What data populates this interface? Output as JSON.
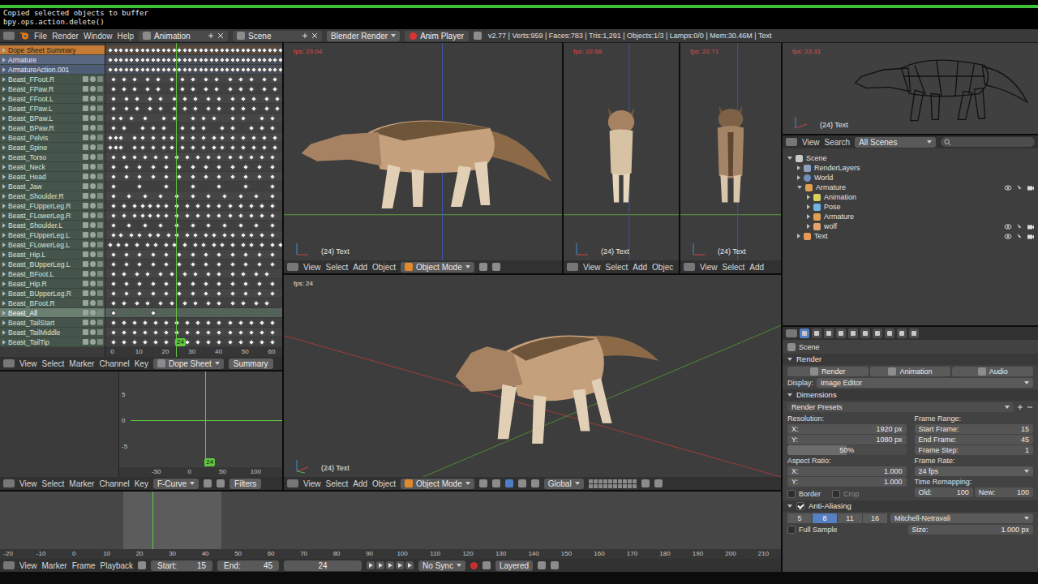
{
  "info": {
    "lines": [
      "Copied selected objects to buffer",
      "bpy.ops.action.delete()"
    ],
    "progress": 1
  },
  "topbar": {
    "menus": [
      "File",
      "Render",
      "Window",
      "Help"
    ],
    "screen_layout": "Animation",
    "scene": "Scene",
    "engine": "Blender Render",
    "anim_player": "Anim Player",
    "stats": "v2.77 | Verts:959 | Faces:783 | Tris:1,291 | Objects:1/3 | Lamps:0/0 | Mem:30.46M | Text"
  },
  "dope_sheet": {
    "rows": [
      {
        "label": "Dope Sheet Summary",
        "kind": "summary",
        "selected": false,
        "keys": [
          -1,
          1,
          3,
          5,
          7,
          9,
          11,
          13,
          15,
          17,
          19,
          21,
          23,
          25,
          27,
          29,
          31,
          33,
          35,
          37,
          39,
          41,
          43,
          45,
          47,
          49,
          51,
          53,
          55,
          57,
          59,
          61,
          63
        ]
      },
      {
        "label": "Armature",
        "kind": "object",
        "selected": false,
        "keys": [
          -1,
          1,
          3,
          5,
          7,
          9,
          11,
          13,
          15,
          17,
          19,
          21,
          23,
          25,
          27,
          29,
          31,
          33,
          35,
          37,
          39,
          41,
          43,
          45,
          47,
          49,
          51,
          53,
          55,
          57,
          59,
          61,
          63
        ]
      },
      {
        "label": "ArmatureAction.001",
        "kind": "action",
        "selected": false,
        "keys": [
          -1,
          1,
          3,
          5,
          7,
          9,
          11,
          13,
          15,
          17,
          19,
          21,
          23,
          25,
          27,
          29,
          31,
          33,
          35,
          37,
          39,
          41,
          43,
          45,
          47,
          49,
          51,
          53,
          55,
          57,
          59,
          61,
          63
        ]
      },
      {
        "label": "Beast_FFoot.R",
        "kind": "bone",
        "selected": false,
        "keys": [
          0,
          4,
          8,
          13,
          17,
          22,
          26,
          30,
          35,
          39,
          44,
          48,
          52,
          57,
          61
        ]
      },
      {
        "label": "Beast_FPaw.R",
        "kind": "bone",
        "selected": false,
        "keys": [
          0,
          4,
          8,
          13,
          17,
          22,
          26,
          30,
          35,
          39,
          44,
          48,
          52,
          57,
          61
        ]
      },
      {
        "label": "Beast_FFoot.L",
        "kind": "bone",
        "selected": false,
        "keys": [
          0,
          5,
          9,
          14,
          18,
          23,
          27,
          31,
          36,
          40,
          45,
          49,
          53,
          58,
          62
        ]
      },
      {
        "label": "Beast_FPaw.L",
        "kind": "bone",
        "selected": false,
        "keys": [
          0,
          5,
          9,
          14,
          18,
          23,
          27,
          31,
          36,
          40,
          45,
          49,
          53,
          58,
          62
        ]
      },
      {
        "label": "Beast_BPaw.L",
        "kind": "bone",
        "selected": false,
        "keys": [
          0,
          3,
          7,
          12,
          19,
          23,
          30,
          34,
          38,
          45,
          49,
          56,
          60
        ]
      },
      {
        "label": "Beast_BPaw.R",
        "kind": "bone",
        "selected": false,
        "keys": [
          0,
          4,
          11,
          15,
          19,
          26,
          30,
          34,
          41,
          45,
          52,
          56,
          60
        ]
      },
      {
        "label": "Beast_Pelvis",
        "kind": "bone",
        "selected": false,
        "keys": [
          -1,
          1,
          3,
          8,
          11,
          15,
          19,
          22,
          26,
          30,
          34,
          38,
          41,
          45,
          49,
          53,
          57,
          61
        ]
      },
      {
        "label": "Beast_Spine",
        "kind": "bone",
        "selected": false,
        "keys": [
          -1,
          1,
          3,
          8,
          11,
          15,
          19,
          22,
          26,
          30,
          34,
          38,
          41,
          45,
          49,
          53,
          57,
          61
        ]
      },
      {
        "label": "Beast_Torso",
        "kind": "bone",
        "selected": false,
        "keys": [
          0,
          4,
          8,
          12,
          16,
          20,
          24,
          28,
          32,
          36,
          40,
          44,
          48,
          52,
          56,
          60
        ]
      },
      {
        "label": "Beast_Neck",
        "kind": "bone",
        "selected": false,
        "keys": [
          0,
          5,
          10,
          15,
          20,
          25,
          30,
          35,
          40,
          45,
          50,
          55,
          60
        ]
      },
      {
        "label": "Beast_Head",
        "kind": "bone",
        "selected": false,
        "keys": [
          0,
          5,
          10,
          15,
          20,
          25,
          30,
          35,
          40,
          45,
          50,
          55,
          60
        ]
      },
      {
        "label": "Beast_Jaw",
        "kind": "bone",
        "selected": false,
        "keys": [
          0,
          10,
          20,
          30,
          40,
          50,
          60
        ]
      },
      {
        "label": "Beast_Shoulder.R",
        "kind": "bone",
        "selected": false,
        "keys": [
          0,
          6,
          12,
          18,
          24,
          30,
          36,
          42,
          48,
          54,
          60
        ]
      },
      {
        "label": "Beast_FUpperLeg.R",
        "kind": "bone",
        "selected": false,
        "keys": [
          0,
          4,
          8,
          11,
          14,
          17,
          20,
          24,
          28,
          32,
          36,
          40,
          44,
          48,
          52,
          56,
          60
        ]
      },
      {
        "label": "Beast_FLowerLeg.R",
        "kind": "bone",
        "selected": false,
        "keys": [
          0,
          4,
          8,
          11,
          14,
          17,
          20,
          24,
          28,
          32,
          36,
          40,
          44,
          48,
          52,
          56,
          60
        ]
      },
      {
        "label": "Beast_Shoulder.L",
        "kind": "bone",
        "selected": false,
        "keys": [
          0,
          6,
          12,
          18,
          24,
          30,
          36,
          42,
          48,
          54,
          60
        ]
      },
      {
        "label": "Beast_FUpperLeg.L",
        "kind": "bone",
        "selected": false,
        "keys": [
          0,
          3,
          7,
          10,
          14,
          17,
          21,
          24,
          28,
          31,
          35,
          38,
          42,
          45,
          49,
          52,
          56,
          60
        ]
      },
      {
        "label": "Beast_FLowerLeg.L",
        "kind": "bone",
        "selected": false,
        "keys": [
          -1,
          2,
          5,
          9,
          13,
          16,
          20,
          23,
          27,
          31,
          34,
          38,
          41,
          45,
          49,
          52,
          56,
          60,
          63
        ]
      },
      {
        "label": "Beast_Hip.L",
        "kind": "bone",
        "selected": false,
        "keys": [
          0,
          5,
          10,
          15,
          20,
          25,
          30,
          35,
          40,
          45,
          50,
          55,
          60
        ]
      },
      {
        "label": "Beast_BUpperLeg.L",
        "kind": "bone",
        "selected": false,
        "keys": [
          0,
          5,
          10,
          15,
          20,
          25,
          30,
          35,
          40,
          45,
          50,
          55,
          60
        ]
      },
      {
        "label": "Beast_BFoot.L",
        "kind": "bone",
        "selected": false,
        "keys": [
          0,
          4,
          9,
          13,
          18,
          22,
          27,
          31,
          36,
          40,
          45,
          49,
          54,
          58
        ]
      },
      {
        "label": "Beast_Hip.R",
        "kind": "bone",
        "selected": false,
        "keys": [
          0,
          5,
          10,
          15,
          20,
          25,
          30,
          35,
          40,
          45,
          50,
          55,
          60
        ]
      },
      {
        "label": "Beast_BUpperLeg.R",
        "kind": "bone",
        "selected": false,
        "keys": [
          0,
          5,
          10,
          15,
          20,
          25,
          30,
          35,
          40,
          45,
          50,
          55,
          60
        ]
      },
      {
        "label": "Beast_BFoot.R",
        "kind": "bone",
        "selected": false,
        "keys": [
          0,
          4,
          9,
          13,
          18,
          22,
          27,
          31,
          36,
          40,
          45,
          49,
          54,
          58
        ]
      },
      {
        "label": "Beast_All",
        "kind": "bone",
        "selected": true,
        "keys": [
          0,
          15
        ]
      },
      {
        "label": "Beast_TailStart",
        "kind": "bone",
        "selected": false,
        "keys": [
          0,
          4,
          8,
          12,
          16,
          20,
          24,
          28,
          32,
          36,
          40,
          44,
          48,
          52,
          56,
          60
        ]
      },
      {
        "label": "Beast_TailMiddle",
        "kind": "bone",
        "selected": false,
        "keys": [
          0,
          4,
          8,
          12,
          16,
          20,
          24,
          28,
          32,
          36,
          40,
          44,
          48,
          52,
          56,
          60
        ]
      },
      {
        "label": "Beast_TailTip",
        "kind": "bone",
        "selected": false,
        "keys": [
          0,
          4,
          8,
          12,
          16,
          20,
          24,
          28,
          32,
          36,
          40,
          44,
          48,
          52,
          56,
          60
        ]
      }
    ],
    "ruler": [
      "0",
      "10",
      "20",
      "30",
      "40",
      "50",
      "60"
    ],
    "current_frame": "24",
    "header": {
      "menus": [
        "View",
        "Select",
        "Marker",
        "Channel",
        "Key"
      ],
      "mode": "Dope Sheet",
      "summary": "Summary"
    }
  },
  "graph_editor": {
    "ruler": [
      "-50",
      "0",
      "50",
      "100"
    ],
    "y_ticks": [
      "5",
      "0",
      "-5"
    ],
    "current_frame": "24",
    "header": {
      "menus": [
        "View",
        "Select",
        "Marker",
        "Channel",
        "Key"
      ],
      "mode": "F-Curve",
      "filters": "Filters"
    }
  },
  "viewports": [
    {
      "kind": "side",
      "fps": "fps: 23.04",
      "slow": true,
      "label": "(24) Text",
      "menus": [
        "View",
        "Select",
        "Add",
        "Object"
      ],
      "mode": "Object Mode"
    },
    {
      "kind": "front",
      "fps": "fps: 22.68",
      "slow": true,
      "label": "(24) Text",
      "menus": [
        "View",
        "Select",
        "Add",
        "Objec"
      ]
    },
    {
      "kind": "back",
      "fps": "fps: 22.71",
      "slow": true,
      "label": "(24) Text",
      "menus": [
        "View",
        "Select",
        "Add"
      ]
    }
  ],
  "main_viewport": {
    "kind": "perspective",
    "fps": "fps: 24",
    "slow": false,
    "label": "(24) Text",
    "menus": [
      "View",
      "Select",
      "Add",
      "Object"
    ],
    "mode": "Object Mode",
    "orientation": "Global"
  },
  "wire_viewport": {
    "kind": "wire",
    "fps": "fps: 23.31",
    "slow": true,
    "label": "(24) Text"
  },
  "outliner": {
    "header": {
      "menus": [
        "View",
        "Search"
      ],
      "filter": "All Scenes"
    },
    "items": [
      {
        "label": "Scene",
        "level": 0,
        "kind": "scene",
        "expanded": true,
        "toggles": false
      },
      {
        "label": "RenderLayers",
        "level": 1,
        "kind": "renderlayers",
        "expanded": false,
        "toggles": false
      },
      {
        "label": "World",
        "level": 1,
        "kind": "world",
        "expanded": false,
        "toggles": false
      },
      {
        "label": "Armature",
        "level": 1,
        "kind": "armature",
        "expanded": true,
        "toggles": true
      },
      {
        "label": "Animation",
        "level": 2,
        "kind": "action",
        "expanded": false,
        "toggles": false
      },
      {
        "label": "Pose",
        "level": 2,
        "kind": "pose",
        "expanded": false,
        "toggles": false
      },
      {
        "label": "Armature",
        "level": 2,
        "kind": "armature-data",
        "expanded": false,
        "toggles": false
      },
      {
        "label": "wolf",
        "level": 2,
        "kind": "mesh",
        "expanded": false,
        "toggles": true
      },
      {
        "label": "Text",
        "level": 1,
        "kind": "text",
        "expanded": false,
        "toggles": true
      }
    ]
  },
  "properties": {
    "tabs": [
      {
        "selected": true
      },
      {
        "selected": false
      },
      {
        "selected": false
      },
      {
        "selected": false
      },
      {
        "selected": false
      },
      {
        "selected": false
      },
      {
        "selected": false
      },
      {
        "selected": false
      },
      {
        "selected": false
      },
      {
        "selected": false
      }
    ],
    "context": "Scene",
    "render_panel": {
      "title": "Render",
      "expanded": true,
      "buttons": [
        "Render",
        "Animation",
        "Audio"
      ],
      "display_label": "Display:",
      "display": "Image Editor"
    },
    "dimensions_panel": {
      "title": "Dimensions",
      "expanded": true,
      "presets": "Render Presets",
      "resolution": {
        "label": "Resolution:",
        "fields": [
          {
            "label": "X:",
            "value": "1920 px"
          },
          {
            "label": "Y:",
            "value": "1080 px"
          }
        ],
        "percent": {
          "value": "50%",
          "level": 0.5
        }
      },
      "frame_range": {
        "label": "Frame Range:",
        "fields": [
          {
            "label": "Start Frame:",
            "value": "15"
          },
          {
            "label": "End Frame:",
            "value": "45"
          },
          {
            "label": "Frame Step:",
            "value": "1"
          }
        ]
      },
      "aspect": {
        "label": "Aspect Ratio:",
        "fields": [
          {
            "label": "X:",
            "value": "1.000"
          },
          {
            "label": "Y:",
            "value": "1.000"
          }
        ]
      },
      "frame_rate": {
        "label": "Frame Rate:",
        "value": "24 fps"
      },
      "border": {
        "label": "Border",
        "checked": false,
        "disabled": false
      },
      "crop": {
        "label": "Crop",
        "checked": false,
        "disabled": true
      },
      "time_remap": {
        "label": "Time Remapping:",
        "old": {
          "label": "Old:",
          "value": "100"
        },
        "new": {
          "label": "New:",
          "value": "100"
        }
      }
    },
    "aa_panel": {
      "title": "Anti-Aliasing",
      "expanded": true,
      "enabled": true,
      "samples": [
        {
          "label": "5",
          "selected": false
        },
        {
          "label": "8",
          "selected": true
        },
        {
          "label": "11",
          "selected": false
        },
        {
          "label": "16",
          "selected": false
        }
      ],
      "filter": "Mitchell-Netravali",
      "full_sample": {
        "label": "Full Sample",
        "checked": false
      },
      "size": {
        "label": "Size:",
        "value": "1.000 px"
      }
    }
  },
  "timeline": {
    "ruler": [
      "-20",
      "-10",
      "0",
      "10",
      "20",
      "30",
      "40",
      "50",
      "60",
      "70",
      "80",
      "90",
      "100",
      "110",
      "120",
      "130",
      "140",
      "150",
      "160",
      "170",
      "180",
      "190",
      "200",
      "210"
    ],
    "start": "15",
    "end": "45",
    "current_frame": "24",
    "header": {
      "menus": [
        "View",
        "Marker",
        "Frame",
        "Playback"
      ],
      "start_label": "Start:",
      "end_label": "End:",
      "sync": "No Sync",
      "keying": "Layered"
    }
  }
}
